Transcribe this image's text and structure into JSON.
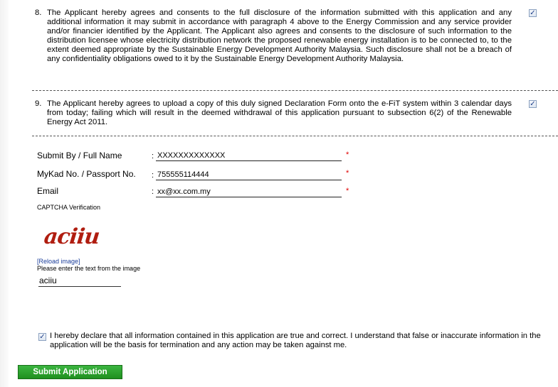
{
  "clauses": [
    {
      "num": "8.",
      "text": "The Applicant hereby agrees and consents to the full disclosure of the information submitted with this application and any additional information it may submit in accordance with paragraph 4 above to the Energy Commission and any service provider and/or financier identified by the Applicant. The Applicant also agrees and consents to the disclosure of such information to the distribution licensee whose electricity distribution network the proposed renewable energy installation is to be connected to, to the extent deemed appropriate by the Sustainable Energy Development Authority Malaysia. Such disclosure shall not be a breach of any confidentiality obligations owed to it by the Sustainable Energy Development Authority Malaysia.",
      "checked": true
    },
    {
      "num": "9.",
      "text": "The Applicant hereby agrees to upload a copy of this duly signed Declaration Form onto the e-FiT system within 3 calendar days from today; failing which will result in the deemed withdrawal of this application pursuant to subsection 6(2) of the Renewable Energy Act 2011.",
      "checked": true
    }
  ],
  "form": {
    "separator": ":",
    "required_mark": "*",
    "name": {
      "label": "Submit By / Full Name",
      "value": "XXXXXXXXXXXXX"
    },
    "id": {
      "label": "MyKad No. / Passport No.",
      "value": "755555114444"
    },
    "email": {
      "label": "Email",
      "value": "xx@xx.com.my"
    }
  },
  "captcha": {
    "label": "CAPTCHA Verification",
    "image_text": "aciiu",
    "reload": "[Reload image]",
    "instruction": "Please enter the text from the image",
    "value": "aciiu"
  },
  "declaration": {
    "text": "I hereby declare that all information contained in this application are true and correct. I understand that false or inaccurate information in the application will be the basis for termination and any action may be taken against me.",
    "checked": true
  },
  "submit_label": "Submit Application",
  "colors": {
    "submit_bg": "#2aa22c",
    "required": "#e00000",
    "link": "#1c3f9b",
    "captcha": "#b01d10"
  }
}
